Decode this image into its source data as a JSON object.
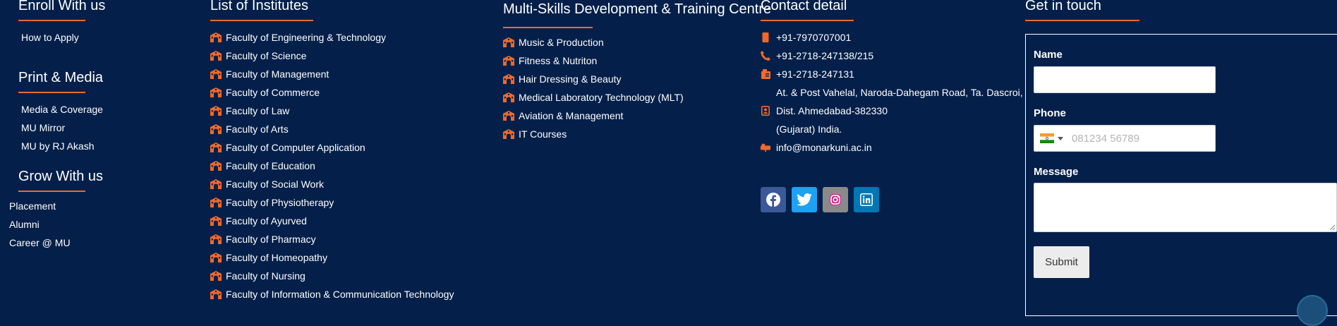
{
  "enroll": {
    "title": "Enroll With us",
    "items": [
      "How to Apply"
    ]
  },
  "print_media": {
    "title": "Print & Media",
    "items": [
      "Media & Coverage",
      "MU Mirror",
      "MU by RJ Akash"
    ]
  },
  "grow": {
    "title": "Grow With us",
    "items": [
      "Placement",
      "Alumni",
      "Career @ MU"
    ]
  },
  "institutes": {
    "title": "List of Institutes",
    "items": [
      "Faculty of Engineering & Technology",
      "Faculty of Science",
      "Faculty of Management",
      "Faculty of Commerce",
      "Faculty of Law",
      "Faculty of Arts",
      "Faculty of Computer Application",
      "Faculty of Education",
      "Faculty of Social Work",
      "Faculty of Physiotherapy",
      "Faculty of Ayurved",
      "Faculty of Pharmacy",
      "Faculty of Homeopathy",
      "Faculty of Nursing",
      "Faculty of Information & Communication Technology"
    ]
  },
  "multiskills": {
    "title": "Multi-Skills Development & Training Centre",
    "items": [
      "Music & Production",
      "Fitness & Nutriton",
      "Hair Dressing & Beauty",
      "Medical Laboratory Technology (MLT)",
      "Aviation & Management",
      "IT Courses"
    ]
  },
  "contact": {
    "title": "Contact detail",
    "mobile": "+91-7970707001",
    "phone": "+91-2718-247138/215",
    "fax": "+91-2718-247131",
    "address_1": "At. & Post Vahelal, Naroda-Dahegam Road, Ta. Dascroi,",
    "address_2": "Dist. Ahmedabad-382330",
    "address_3": "(Gujarat) India.",
    "email": "info@monarkuni.ac.in"
  },
  "social": {
    "icons": [
      "facebook-icon",
      "twitter-icon",
      "instagram-icon",
      "linkedin-icon"
    ],
    "colors": {
      "facebook": "#3b5998",
      "twitter": "#1da1f2",
      "instagram": "#8a8a8a",
      "linkedin": "#0077b5"
    }
  },
  "form": {
    "title": "Get in touch",
    "name_label": "Name",
    "phone_label": "Phone",
    "phone_placeholder": "081234 56789",
    "message_label": "Message",
    "submit_label": "Submit"
  },
  "colors": {
    "background": "#04204a",
    "accent": "#f0692a",
    "text": "#ffffff"
  }
}
